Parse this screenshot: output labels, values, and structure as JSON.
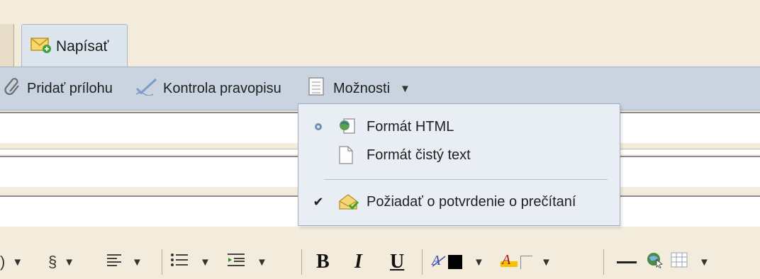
{
  "tab": {
    "compose_label": "Napísať"
  },
  "toolbar": {
    "attach_label": "Pridať prílohu",
    "spellcheck_label": "Kontrola pravopisu",
    "options_label": "Možnosti",
    "options_caret": "▼"
  },
  "options_menu": {
    "items": [
      {
        "label": "Formát HTML",
        "selected": true,
        "indicator": "●"
      },
      {
        "label": "Formát čistý text",
        "selected": false,
        "indicator": ""
      },
      {
        "label": "Požiadať o potvrdenie o prečítaní",
        "checked": true,
        "indicator": "✔"
      }
    ]
  },
  "format_toolbar": {
    "font_tail": "​)",
    "section_sign": "§",
    "bold": "B",
    "italic": "I",
    "underline": "U",
    "caret": "▼"
  },
  "colors": {
    "toolbar_bg": "#c9d4e0",
    "menu_bg": "#e9eef4",
    "page_bg": "#f3ecdd",
    "radio_blue": "#6f8fb5"
  }
}
